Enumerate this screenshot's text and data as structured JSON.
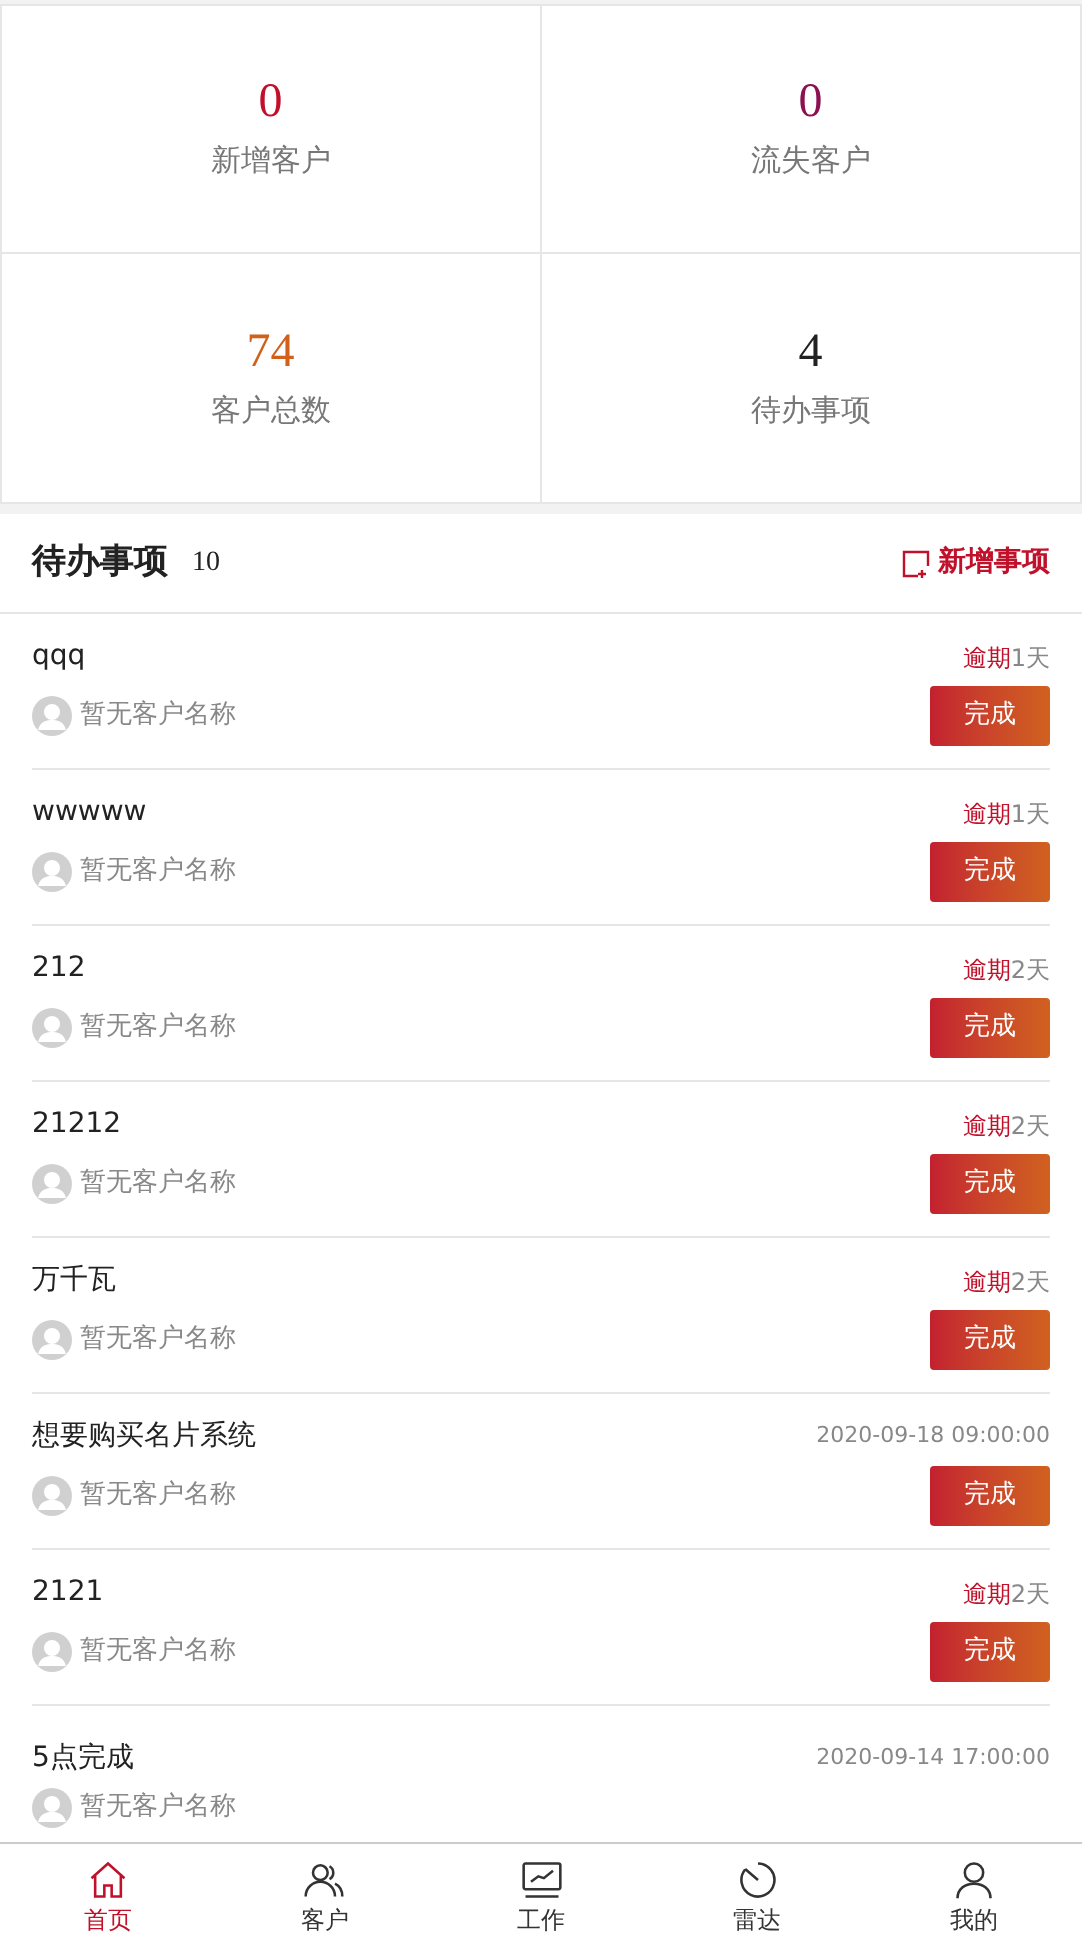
{
  "stats": [
    {
      "value": "0",
      "label": "新增客户",
      "color": "#c0102a"
    },
    {
      "value": "0",
      "label": "流失客户",
      "color": "#8b1150"
    },
    {
      "value": "74",
      "label": "客户总数",
      "color": "#d0601a"
    },
    {
      "value": "4",
      "label": "待办事项",
      "color": "#222222"
    }
  ],
  "todo_header": {
    "title": "待办事项",
    "count": "10",
    "add_link": "新增事项"
  },
  "tasks": [
    {
      "title": "qqq",
      "customer": "暂无客户名称",
      "kind": "overdue",
      "overdue_label": "逾期",
      "overdue_days": "1天",
      "action": "完成"
    },
    {
      "title": "wwwww",
      "customer": "暂无客户名称",
      "kind": "overdue",
      "overdue_label": "逾期",
      "overdue_days": "1天",
      "action": "完成"
    },
    {
      "title": "212",
      "customer": "暂无客户名称",
      "kind": "overdue",
      "overdue_label": "逾期",
      "overdue_days": "2天",
      "action": "完成"
    },
    {
      "title": "21212",
      "customer": "暂无客户名称",
      "kind": "overdue",
      "overdue_label": "逾期",
      "overdue_days": "2天",
      "action": "完成"
    },
    {
      "title": "万千瓦",
      "customer": "暂无客户名称",
      "kind": "overdue",
      "overdue_label": "逾期",
      "overdue_days": "2天",
      "action": "完成"
    },
    {
      "title": "想要购买名片系统",
      "customer": "暂无客户名称",
      "kind": "date",
      "date": "2020-09-18 09:00:00",
      "action": "完成"
    },
    {
      "title": "2121",
      "customer": "暂无客户名称",
      "kind": "overdue",
      "overdue_label": "逾期",
      "overdue_days": "2天",
      "action": "完成"
    },
    {
      "title": "5点完成",
      "customer": "暂无客户名称",
      "kind": "date",
      "date": "2020-09-14 17:00:00"
    }
  ],
  "tab_bar": [
    {
      "label": "首页",
      "selected": true
    },
    {
      "label": "客户",
      "selected": false
    },
    {
      "label": "工作",
      "selected": false
    },
    {
      "label": "雷达",
      "selected": false
    },
    {
      "label": "我的",
      "selected": false
    }
  ]
}
